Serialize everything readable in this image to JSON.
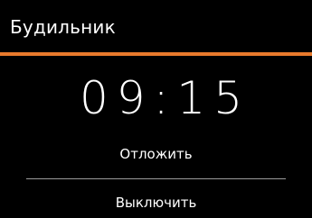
{
  "header": {
    "title": "Будильник"
  },
  "alarm": {
    "time": "09:15"
  },
  "actions": {
    "snooze_label": "Отложить",
    "stop_label": "Выключить"
  },
  "colors": {
    "background": "#000000",
    "accent": "#e87a2c",
    "text": "#ffffff",
    "divider": "#9a9a9a"
  }
}
